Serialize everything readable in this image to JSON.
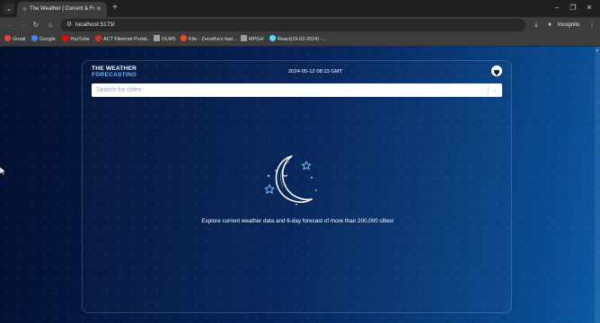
{
  "browser": {
    "tab_title": "The Weather | Current & Forecast",
    "tab_favicon": "weather-favicon",
    "url": "localhost:5173/",
    "incognito_label": "Incognito",
    "bookmarks": [
      {
        "label": "Gmail",
        "icon": "gmail-icon",
        "color": "#ea4335"
      },
      {
        "label": "Google",
        "icon": "google-icon",
        "color": "#4285f4"
      },
      {
        "label": "YouTube",
        "icon": "youtube-icon",
        "color": "#ff0000"
      },
      {
        "label": "ACT Fibernet Portal...",
        "icon": "act-icon",
        "color": "#d93025"
      },
      {
        "label": "OLMS",
        "icon": "olms-icon",
        "color": "#9aa0a6"
      },
      {
        "label": "Kite - Zerodha's fast...",
        "icon": "kite-icon",
        "color": "#f6461a"
      },
      {
        "label": "MPGH",
        "icon": "mpgh-icon",
        "color": "#9aa0a6"
      },
      {
        "label": "React(19-02-2024) -...",
        "icon": "react-icon",
        "color": "#61dafb"
      }
    ]
  },
  "app": {
    "logo_line1": "THE WEATHER",
    "logo_line2": "FORECASTING",
    "datetime": "2024-05-12 08:13 GMT",
    "search_placeholder": "Search for cities",
    "tagline": "Explore current weather data and 6-day forecast of more than 200,000 cities!",
    "illustration": "moon-stars-illustration",
    "accent_color": "#6fb4ff"
  }
}
